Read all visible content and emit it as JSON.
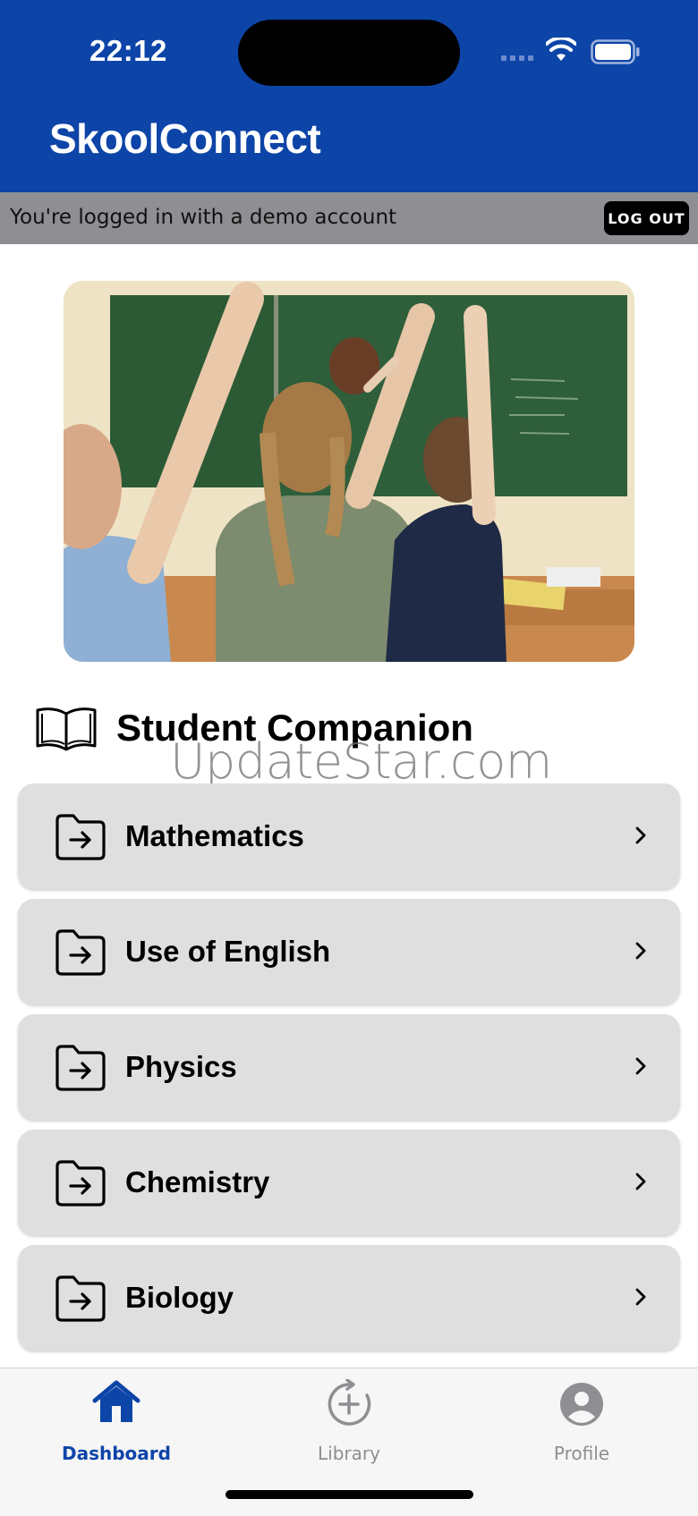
{
  "status_bar": {
    "time": "22:12"
  },
  "app": {
    "title": "SkoolConnect",
    "brand_color": "#0D44A8"
  },
  "demo_banner": {
    "message": "You're logged in with a demo account",
    "logout_label": "LOG OUT"
  },
  "hero": {
    "image_description_icon": "classroom-photo"
  },
  "section": {
    "title": "Student Companion",
    "icon": "book-icon"
  },
  "watermark": "UpdateStar.com",
  "subjects": [
    {
      "label": "Mathematics"
    },
    {
      "label": "Use of English"
    },
    {
      "label": "Physics"
    },
    {
      "label": "Chemistry"
    },
    {
      "label": "Biology"
    }
  ],
  "tabs": [
    {
      "label": "Dashboard",
      "icon": "home-icon",
      "active": true
    },
    {
      "label": "Library",
      "icon": "add-circle-icon",
      "active": false
    },
    {
      "label": "Profile",
      "icon": "person-icon",
      "active": false
    }
  ]
}
